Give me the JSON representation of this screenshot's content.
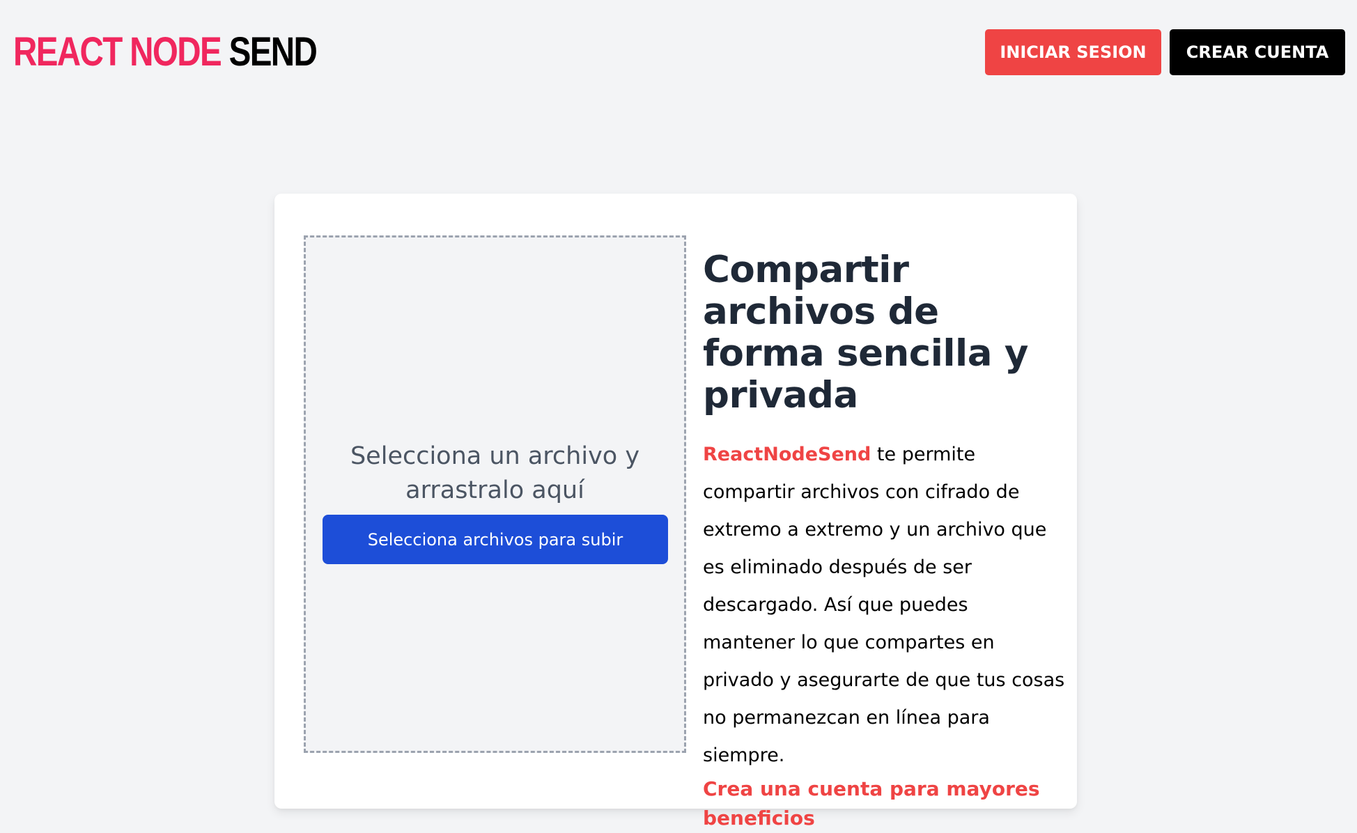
{
  "header": {
    "logo_part1": "REACT NODE",
    "logo_part2": "SEND",
    "login_label": "INICIAR SESION",
    "signup_label": "CREAR CUENTA"
  },
  "dropzone": {
    "instruction": "Selecciona un archivo y arrastralo aquí",
    "button_label": "Selecciona archivos para subir"
  },
  "info": {
    "title": "Compartir archivos de forma sencilla y privada",
    "brand": "ReactNodeSend",
    "body": " te permite compartir archivos con cifrado de extremo a extremo y un archivo que es eliminado después de ser descargado. Así que puedes mantener lo que compartes en privado y asegurarte de que tus cosas no permanezcan en línea para siempre.",
    "cta": "Crea una cuenta para mayores beneficios"
  },
  "colors": {
    "accent_red": "#ef4444",
    "logo_pink": "#f0275e",
    "primary_blue": "#1d4ed8",
    "background": "#f3f4f6"
  }
}
